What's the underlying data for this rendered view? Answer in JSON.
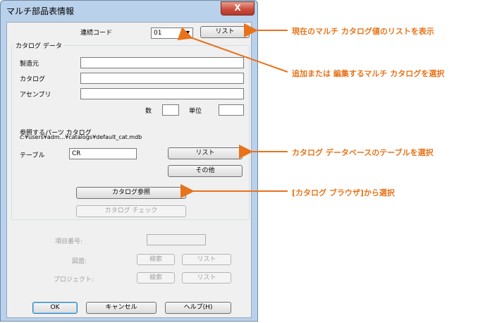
{
  "window": {
    "title": "マルチ部品表情報",
    "close_glyph": "X"
  },
  "serial": {
    "label": "連続コード",
    "value": "01",
    "list_button": "リスト"
  },
  "catalog": {
    "group_label": "カタログ データ",
    "manufacturer_label": "製造元",
    "catalog_label": "カタログ",
    "assembly_label": "アセンブリ",
    "quantity_label": "数",
    "unit_label": "単位",
    "ref_label": "参照するパーツ カタログ",
    "ref_path": "c:¥users¥adm...¥catalogs¥default_cat.mdb",
    "table_label": "テーブル",
    "table_value": "CR",
    "list_button": "リスト",
    "other_button": "その他",
    "browse_button": "カタログ参照",
    "check_button": "カタログ チェック"
  },
  "item": {
    "item_number_label": "項目番号:",
    "drawing_label": "図面:",
    "project_label": "プロジェクト:",
    "search_button": "検索",
    "list_button": "リスト"
  },
  "footer": {
    "ok": "OK",
    "cancel": "キャンセル",
    "help": "ヘルプ(H)"
  },
  "annotations": [
    "現在のマルチ カタログ値のリストを表示",
    "追加または 編集するマルチ カタログを選択",
    "カタログ データベースのテーブルを選択",
    "[カタログ ブラウザ]から選択"
  ],
  "colors": {
    "annotation": "#e8731a",
    "frame": "#b9d1ea",
    "close": "#c94a3a"
  }
}
